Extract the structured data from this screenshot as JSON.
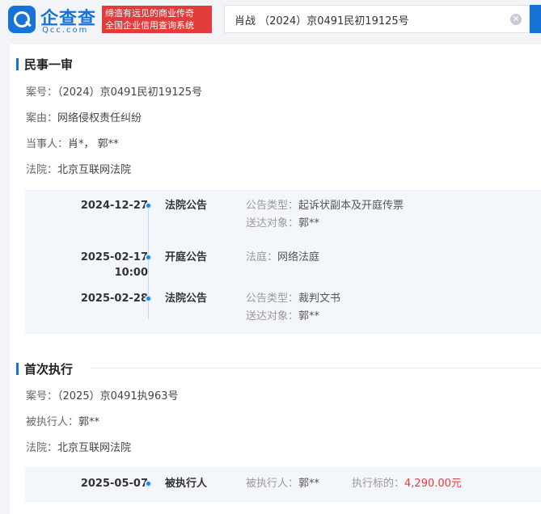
{
  "header": {
    "logo_name": "企查查",
    "logo_domain": "Qcc.com",
    "slogan_line1": "缔造有远见的商业传奇",
    "slogan_line2": "全国企业信用查询系统",
    "search_value": "肖战 （2024）京0491民初19125号",
    "clear_glyph": "✕",
    "brand_color": "#1873d6",
    "slogan_color": "#e23c3a"
  },
  "sections": [
    {
      "title": "民事一审",
      "fields": [
        {
          "label": "案号：",
          "value": "（2024）京0491民初19125号"
        },
        {
          "label": "案由：",
          "value": "网络侵权责任纠纷"
        },
        {
          "label": "当事人：",
          "value": "肖*， 郭**"
        },
        {
          "label": "法院：",
          "value": "北京互联网法院"
        }
      ],
      "timeline": [
        {
          "date": "2024-12-27",
          "date2": "",
          "type": "法院公告",
          "details": [
            {
              "k": "公告类型：",
              "v": "起诉状副本及开庭传票"
            },
            {
              "k": "送达对象：",
              "v": "郭**"
            }
          ]
        },
        {
          "date": "2025-02-17",
          "date2": "10:00",
          "type": "开庭公告",
          "details": [
            {
              "k": "法庭：",
              "v": "网络法庭"
            }
          ]
        },
        {
          "date": "2025-02-28",
          "date2": "",
          "type": "法院公告",
          "details": [
            {
              "k": "公告类型：",
              "v": "裁判文书"
            },
            {
              "k": "送达对象：",
              "v": "郭**"
            }
          ]
        }
      ]
    },
    {
      "title": "首次执行",
      "fields": [
        {
          "label": "案号：",
          "value": "（2025）京0491执963号"
        },
        {
          "label": "被执行人：",
          "value": "郭**"
        },
        {
          "label": "法院：",
          "value": "北京互联网法院"
        }
      ],
      "timeline": [
        {
          "date": "2025-05-07",
          "type": "被执行人",
          "detail_k1": "被执行人：",
          "detail_v1": "郭**",
          "detail_k2": "执行标的：",
          "detail_v2": "4,290.00元"
        }
      ]
    }
  ]
}
